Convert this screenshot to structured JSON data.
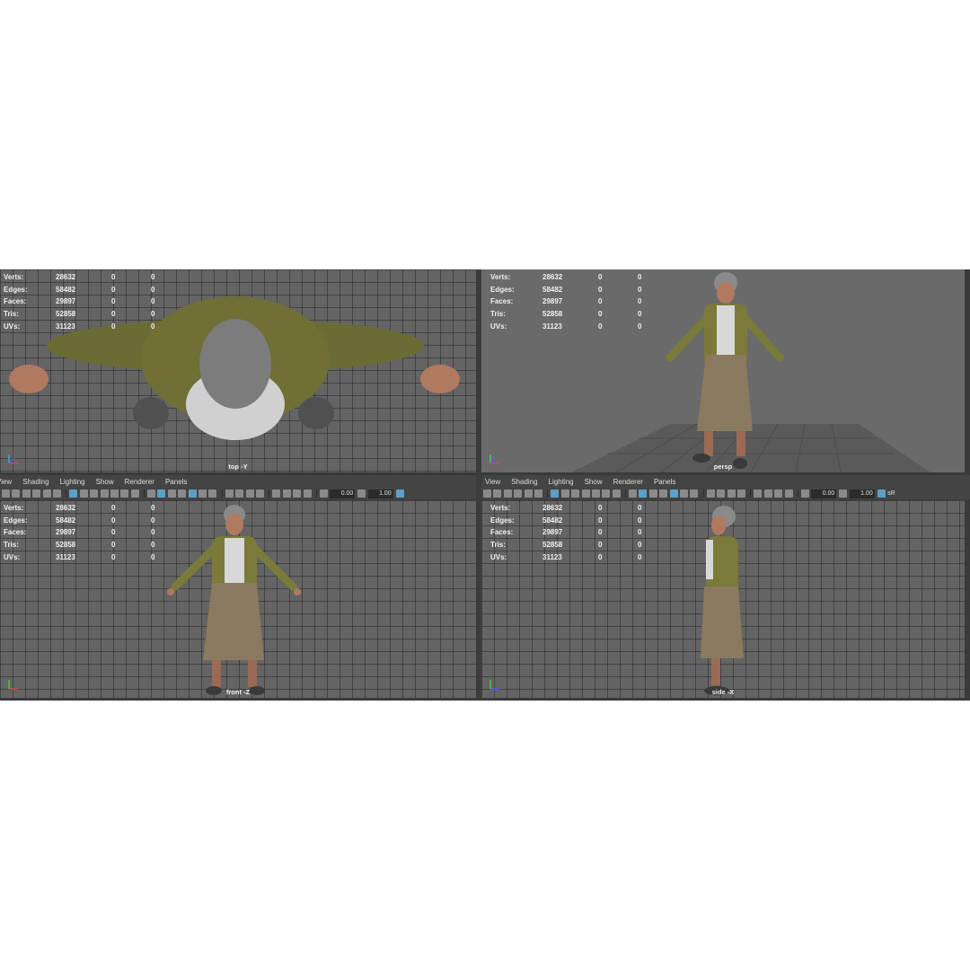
{
  "panel_menu": [
    "View",
    "Shading",
    "Lighting",
    "Show",
    "Renderer",
    "Panels"
  ],
  "hud_labels": [
    "Verts:",
    "Edges:",
    "Faces:",
    "Tris:",
    "UVs:"
  ],
  "hud_values": [
    [
      "28632",
      "0",
      "0"
    ],
    [
      "58482",
      "0",
      "0"
    ],
    [
      "29897",
      "0",
      "0"
    ],
    [
      "52858",
      "0",
      "0"
    ],
    [
      "31123",
      "0",
      "0"
    ]
  ],
  "viewports": {
    "top": {
      "camera": "top -Y"
    },
    "persp": {
      "camera": "persp"
    },
    "front": {
      "camera": "front -Z"
    },
    "side": {
      "camera": "side -X"
    }
  },
  "toolbar": {
    "exposure": "0.00",
    "gamma": "1.00",
    "color_space": "sR"
  },
  "colors": {
    "viewport_bg": "#646464",
    "panel_bg": "#444444",
    "highlight": "#5aa0c8",
    "jacket": "#7a7a3a",
    "skirt": "#8a7a60",
    "skin": "#b07a60",
    "hair": "#8a8a8a"
  }
}
